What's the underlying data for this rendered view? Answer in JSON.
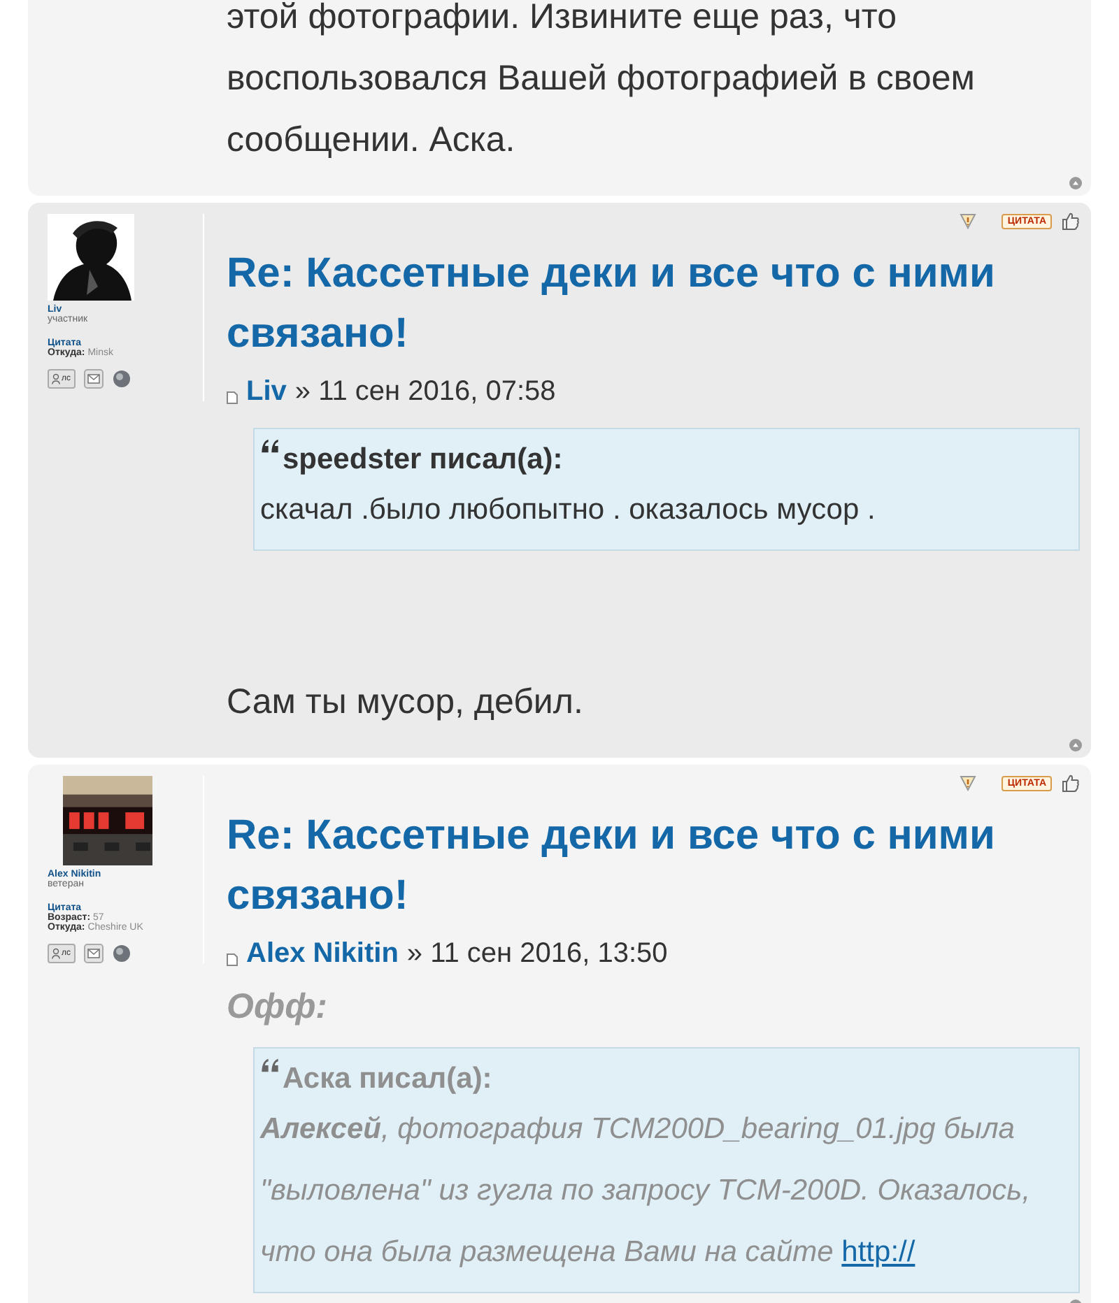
{
  "top_post": {
    "text": "этой фотографии. Извините еще раз, что воспользовался Вашей фотографией в своем сообщении. Аска."
  },
  "posts": [
    {
      "avatar": {
        "kind": "picture"
      },
      "profile_name": "Liv",
      "author": "Liv",
      "rank": "участник",
      "quote_link": "Цитата",
      "fields": [
        {
          "label": "Откуда:",
          "value": "Minsk"
        }
      ],
      "pm_label": "лс",
      "quote_button": "ЦИТАТА",
      "title": "Re: Кассетные деки и все что с ними связано!",
      "date": "» 11 сен 2016, 07:58",
      "blocks": [
        {
          "kind": "quote",
          "muted": false,
          "cite": "speedster писал(а):",
          "text": "скачал .было любопытно . оказалось мусор ."
        },
        {
          "kind": "paragraph",
          "text": "Сам ты мусор, дебил."
        }
      ]
    },
    {
      "avatar": {
        "kind": "picture"
      },
      "profile_name": "Alex Nikitin",
      "author": "Alex Nikitin",
      "rank": "ветеран",
      "quote_link": "Цитата",
      "fields": [
        {
          "label": "Возраст:",
          "value": "57"
        },
        {
          "label": "Откуда:",
          "value": "Cheshire UK"
        }
      ],
      "pm_label": "лс",
      "quote_button": "ЦИТАТА",
      "title": "Re: Кассетные деки и все что с ними связано!",
      "date": "» 11 сен 2016, 13:50",
      "blocks": [
        {
          "kind": "offtopic",
          "text": "Офф:"
        },
        {
          "kind": "quote",
          "muted": true,
          "cite": "Аска писал(а):",
          "text": "**Алексей**, фотография TCM200D_bearing_01.jpg была \"выловлена\" из гугла по запросу TCM-200D. Оказалось, что она была размещена Вами на сайте ",
          "link": "http://"
        }
      ]
    }
  ]
}
